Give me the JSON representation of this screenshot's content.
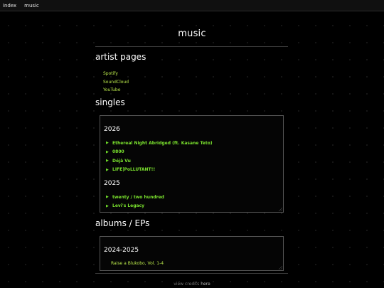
{
  "nav": {
    "items": [
      {
        "label": "index"
      },
      {
        "label": "music"
      }
    ]
  },
  "page": {
    "title": "music"
  },
  "artist_pages": {
    "heading": "artist pages",
    "links": [
      {
        "label": "Spotify"
      },
      {
        "label": "SoundCloud"
      },
      {
        "label": "YouTube"
      }
    ]
  },
  "singles": {
    "heading": "singles",
    "groups": [
      {
        "year": "2026",
        "tracks": [
          {
            "title": "Ethereal Night Abridged (ft. Kasane Teto)"
          },
          {
            "title": "0800"
          },
          {
            "title": "Déjà Vu"
          },
          {
            "title": "LIFE|PoLLUTANT!!"
          }
        ]
      },
      {
        "year": "2025",
        "tracks": [
          {
            "title": "twenty / two hundred"
          },
          {
            "title": "Levi's Legacy"
          }
        ]
      }
    ]
  },
  "albums": {
    "heading": "albums / EPs",
    "groups": [
      {
        "year": "2024-2025",
        "items": [
          {
            "title": "Raise a Blukobo, Vol. 1-4"
          }
        ]
      }
    ]
  },
  "footer": {
    "prefix": "view credits ",
    "link": "here"
  },
  "colors": {
    "link": "#b8e64a",
    "track": "#7be32e",
    "background": "#000000"
  },
  "icons": {
    "track_bullet": "play-triangle-icon"
  }
}
